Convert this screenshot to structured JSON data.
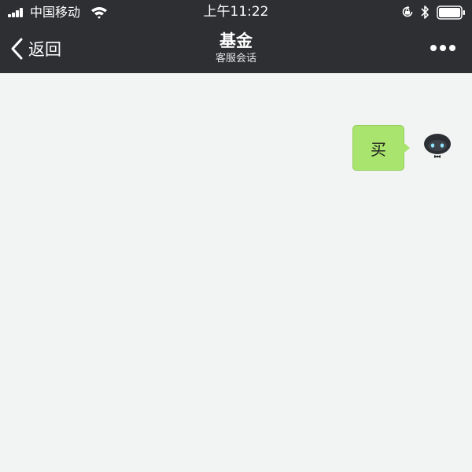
{
  "status_bar": {
    "carrier": "中国移动",
    "time": "上午11:22",
    "icons": [
      "signal-icon",
      "wifi-icon",
      "rotation-lock-icon",
      "bluetooth-icon",
      "battery-icon"
    ]
  },
  "nav": {
    "back_label": "返回",
    "title": "基金",
    "subtitle": "客服会话",
    "more_icon": "more-dots-icon"
  },
  "chat": {
    "messages": [
      {
        "from": "user",
        "text": "买"
      }
    ],
    "bubble_color": "#a9e46f",
    "avatar_icon": "robot-avatar-icon"
  },
  "colors": {
    "header_bg": "#2e2f33",
    "chat_bg": "#f2f4f4",
    "bubble": "#a9e46f"
  }
}
